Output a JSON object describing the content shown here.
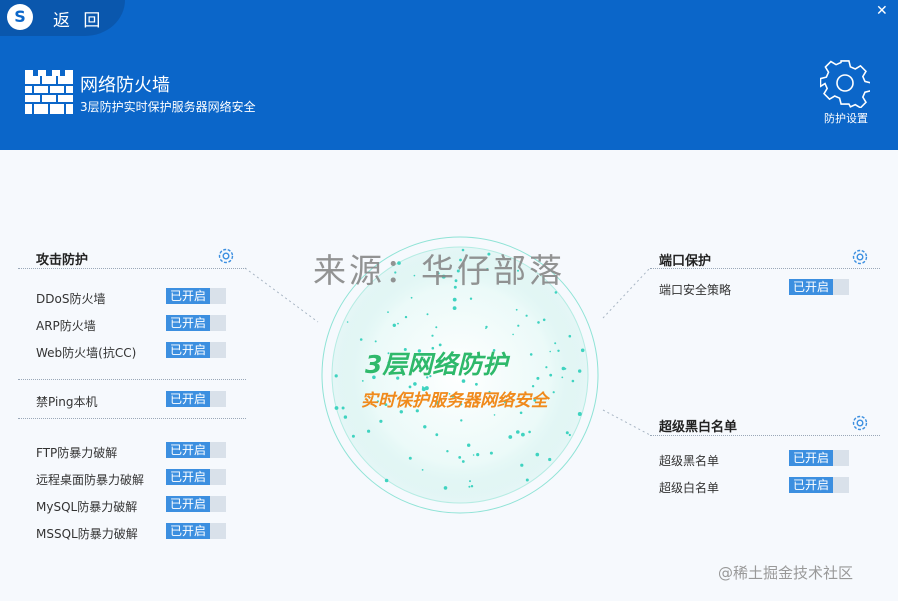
{
  "header": {
    "logo_letter": "S",
    "back_label": "返 回",
    "close_glyph": "✕",
    "title": "网络防火墙",
    "subtitle": "3层防护实时保护服务器网络安全",
    "settings_label": "防护设置",
    "bg_color": "#0b66c9"
  },
  "attack": {
    "title": "攻击防护",
    "items": [
      {
        "label": "DDoS防火墙",
        "status": "已开启"
      },
      {
        "label": "ARP防火墙",
        "status": "已开启"
      },
      {
        "label": "Web防火墙(抗CC)",
        "status": "已开启"
      }
    ],
    "ping": {
      "label": "禁Ping本机",
      "status": "已开启"
    },
    "brute": [
      {
        "label": "FTP防暴力破解",
        "status": "已开启"
      },
      {
        "label": "远程桌面防暴力破解",
        "status": "已开启"
      },
      {
        "label": "MySQL防暴力破解",
        "status": "已开启"
      },
      {
        "label": "MSSQL防暴力破解",
        "status": "已开启"
      }
    ]
  },
  "port": {
    "title": "端口保护",
    "items": [
      {
        "label": "端口安全策略",
        "status": "已开启"
      }
    ]
  },
  "lists": {
    "title": "超级黑白名单",
    "items": [
      {
        "label": "超级黑名单",
        "status": "已开启"
      },
      {
        "label": "超级白名单",
        "status": "已开启"
      }
    ]
  },
  "center": {
    "title": "3层网络防护",
    "subtitle": "实时保护服务器网络安全"
  },
  "watermark": "来源：华仔部落",
  "footer_mark": "@稀土掘金技术社区",
  "colors": {
    "toggle_on": "#3c8fe0",
    "accent_green": "#2fb96b",
    "accent_orange": "#f08a1c"
  }
}
